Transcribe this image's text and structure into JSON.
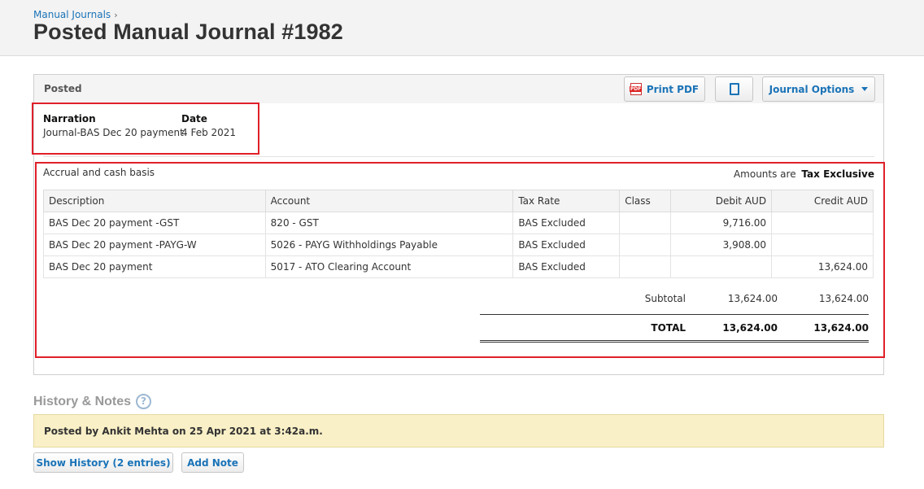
{
  "breadcrumb": {
    "link": "Manual Journals",
    "separator": "›"
  },
  "page_title": "Posted Manual Journal #1982",
  "panel": {
    "status": "Posted",
    "print_pdf_label": "Print PDF",
    "copy_icon": "copy-icon",
    "journal_options_label": "Journal Options"
  },
  "details": {
    "narration_label": "Narration",
    "narration_value": "Journal-BAS Dec 20 payment",
    "date_label": "Date",
    "date_value": "4 Feb 2021"
  },
  "basis": "Accrual and cash basis",
  "amounts": {
    "prefix": "Amounts are",
    "mode": "Tax Exclusive"
  },
  "table": {
    "headers": [
      "Description",
      "Account",
      "Tax Rate",
      "Class",
      "Debit AUD",
      "Credit AUD"
    ],
    "rows": [
      [
        "BAS Dec 20 payment -GST",
        "820 - GST",
        "BAS Excluded",
        "",
        "9,716.00",
        ""
      ],
      [
        "BAS Dec 20 payment -PAYG-W",
        "5026 - PAYG Withholdings Payable",
        "BAS Excluded",
        "",
        "3,908.00",
        ""
      ],
      [
        "BAS Dec 20 payment",
        "5017 - ATO Clearing Account",
        "BAS Excluded",
        "",
        "",
        "13,624.00"
      ]
    ]
  },
  "totals": {
    "subtotal_label": "Subtotal",
    "subtotal_debit": "13,624.00",
    "subtotal_credit": "13,624.00",
    "total_label": "TOTAL",
    "total_debit": "13,624.00",
    "total_credit": "13,624.00"
  },
  "history": {
    "title": "History & Notes",
    "help_icon": "?",
    "note": "Posted by Ankit Mehta on 25 Apr 2021 at 3:42a.m.",
    "show_history_label": "Show History (2 entries)",
    "add_note_label": "Add Note"
  },
  "colors": {
    "accent": "#1a73b7",
    "highlight": "#e0202a",
    "note_bg": "#faf0c7"
  }
}
